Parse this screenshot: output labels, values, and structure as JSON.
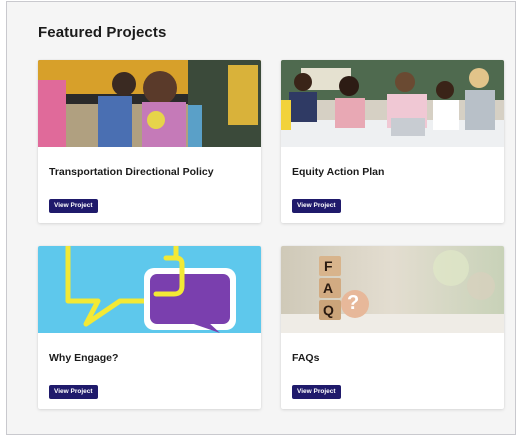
{
  "section": {
    "title": "Featured Projects"
  },
  "cards": [
    {
      "title": "Transportation Directional Policy",
      "button": "View Project",
      "image": "school-bus-children-photo"
    },
    {
      "title": "Equity Action Plan",
      "button": "View Project",
      "image": "classroom-students-photo"
    },
    {
      "title": "Why Engage?",
      "button": "View Project",
      "image": "speech-bubbles-illustration"
    },
    {
      "title": "FAQs",
      "button": "View Project",
      "image": "faq-wooden-blocks-photo"
    }
  ],
  "faq_blocks": [
    "F",
    "A",
    "Q",
    "?"
  ],
  "colors": {
    "button_bg": "#1f1a6b",
    "engage_sky": "#5ec8ec",
    "engage_purple": "#7a3fae",
    "engage_yellow": "#f3e935"
  }
}
